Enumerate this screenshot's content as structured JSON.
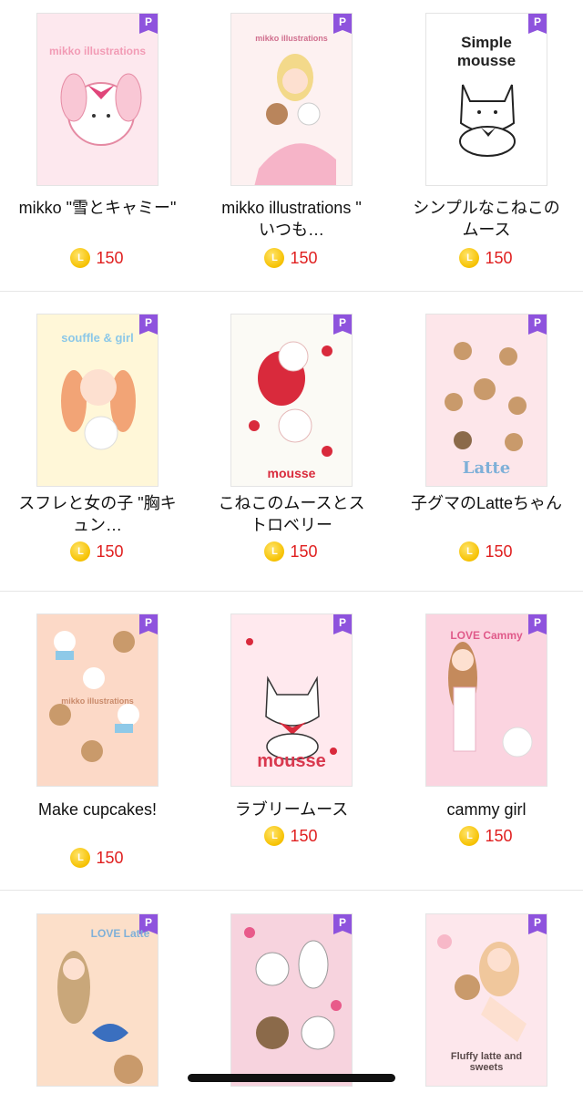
{
  "badge_label": "P",
  "coin_symbol": "L",
  "products": [
    {
      "title": "mikko \"雪とキャミー\"",
      "price": "150",
      "art_text": "mikko illustrations",
      "bg": "#fde8ee"
    },
    {
      "title": "mikko illustrations \" いつも…",
      "price": "150",
      "art_text": "mikko illustrations",
      "bg": "#fdf1f1"
    },
    {
      "title": "シンプルなこねこのムース",
      "price": "150",
      "art_text": "Simple mousse",
      "bg": "#ffffff"
    },
    {
      "title": "スフレと女の子 \"胸キュン…",
      "price": "150",
      "art_text": "souffle & girl",
      "bg": "#fff7d8"
    },
    {
      "title": "こねこのムースとストロベリー",
      "price": "150",
      "art_text": "mousse",
      "bg": "#fbfaf5"
    },
    {
      "title": "子グマのLatteちゃん",
      "price": "150",
      "art_text": "Latte",
      "bg": "#fde6ea"
    },
    {
      "title": "Make cupcakes!",
      "price": "150",
      "art_text": "mikko illustrations",
      "bg": "#fcd9c7"
    },
    {
      "title": "ラブリームース",
      "price": "150",
      "art_text": "mousse",
      "bg": "#ffe9ee"
    },
    {
      "title": "cammy girl",
      "price": "150",
      "art_text": "LOVE Cammy",
      "bg": "#fbd4e0"
    },
    {
      "title": "",
      "price": "",
      "art_text": "LOVE Latte",
      "bg": "#fcdfc9"
    },
    {
      "title": "",
      "price": "",
      "art_text": "",
      "bg": "#f7d3de"
    },
    {
      "title": "",
      "price": "",
      "art_text": "Fluffy latte and sweets",
      "bg": "#fde7ec"
    }
  ]
}
